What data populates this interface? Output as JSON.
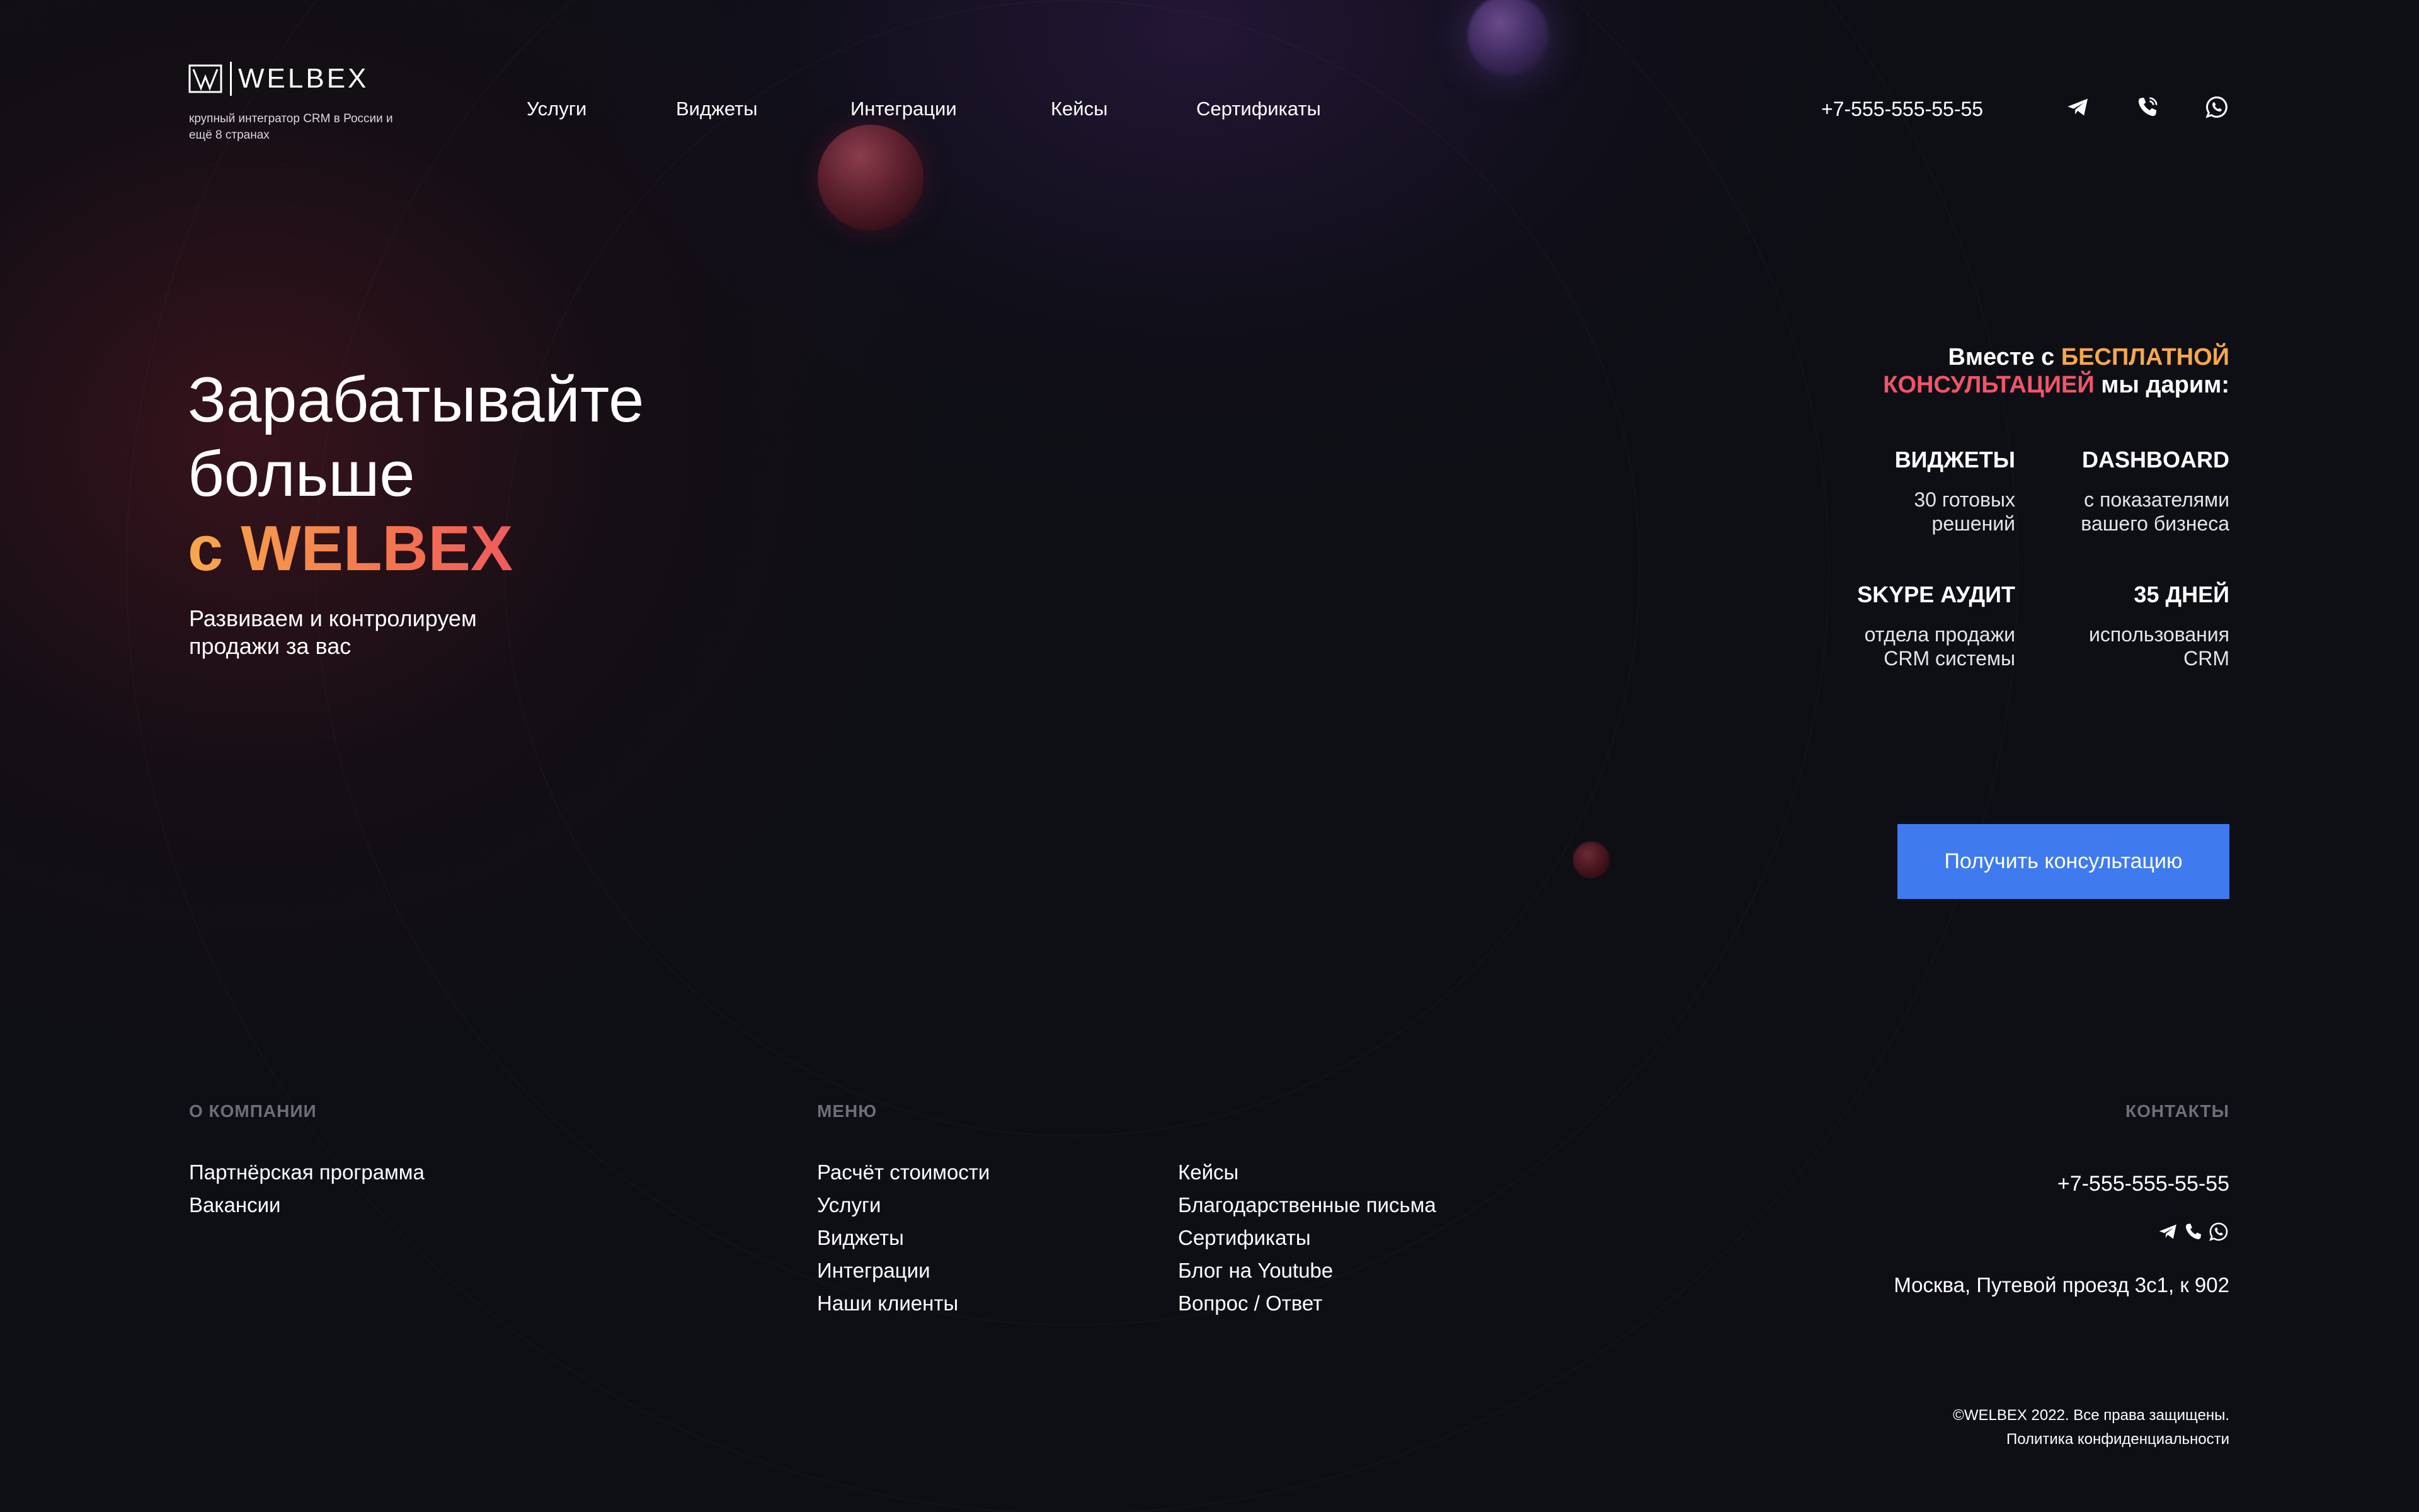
{
  "brand": {
    "name": "WELBEX",
    "tagline": "крупный интегратор CRM в России и ещё 8 странах"
  },
  "nav": {
    "items": [
      "Услуги",
      "Виджеты",
      "Интеграции",
      "Кейсы",
      "Сертификаты"
    ]
  },
  "header": {
    "phone": "+7-555-555-55-55",
    "icons": [
      "telegram-icon",
      "phone-icon",
      "whatsapp-icon"
    ]
  },
  "hero": {
    "title_line1": "Зарабатывайте",
    "title_line2": "больше",
    "title_line3_prefix": "с",
    "title_line3_brand": "WELBEX",
    "subtitle": "Развиваем и контролируем продажи за вас"
  },
  "offer": {
    "part1": "Вместе с",
    "highlight1": "БЕСПЛАТНОЙ",
    "highlight2": "КОНСУЛЬТАЦИЕЙ",
    "part2": "мы дарим:",
    "features": [
      {
        "title": "ВИДЖЕТЫ",
        "desc": "30 готовых решений"
      },
      {
        "title": "DASHBOARD",
        "desc": "с показателями вашего бизнеса"
      },
      {
        "title": "SKYPE АУДИТ",
        "desc": "отдела продажи CRM системы"
      },
      {
        "title": "35 ДНЕЙ",
        "desc": "использования CRM"
      }
    ],
    "cta_label": "Получить консультацию"
  },
  "footer": {
    "company_heading": "О КОМПАНИИ",
    "company_links": [
      "Партнёрская программа",
      "Вакансии"
    ],
    "menu_heading": "МЕНЮ",
    "menu_col1": [
      "Расчёт стоимости",
      "Услуги",
      "Виджеты",
      "Интеграции",
      "Наши клиенты"
    ],
    "menu_col2": [
      "Кейсы",
      "Благодарственные письма",
      "Сертификаты",
      "Блог на Youtube",
      "Вопрос / Ответ"
    ],
    "contacts_heading": "КОНТАКТЫ",
    "phone": "+7-555-555-55-55",
    "address": "Москва, Путевой проезд 3с1, к 902",
    "copyright": "©WELBEX 2022. Все права защищены.",
    "privacy": "Политика конфиденциальности"
  },
  "colors": {
    "background": "#0e0f15",
    "accent_orange": "#f7a84b",
    "accent_pink": "#ea3f6c",
    "button": "#3f7bee",
    "muted_heading": "#6c6f78"
  }
}
